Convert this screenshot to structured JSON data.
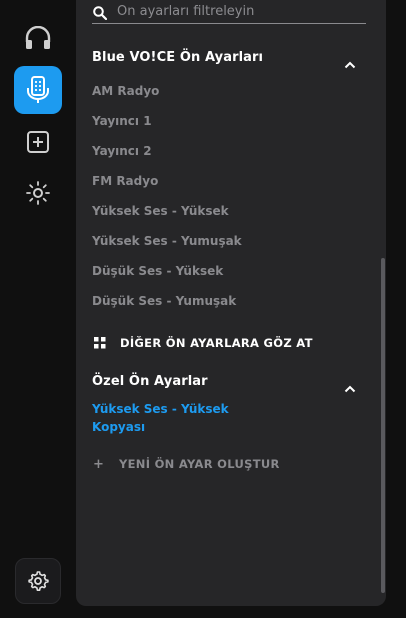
{
  "sidebar": {
    "items": [
      {
        "name": "headphones-icon",
        "active": false
      },
      {
        "name": "microphone-icon",
        "active": true
      },
      {
        "name": "add-icon",
        "active": false
      },
      {
        "name": "lighting-icon",
        "active": false
      }
    ],
    "settings_icon": "gear-icon"
  },
  "search": {
    "placeholder": "Ön ayarları filtreleyin",
    "value": ""
  },
  "blue_voice": {
    "title": "Blue VO!CE Ön Ayarları",
    "presets": [
      "AM Radyo",
      "Yayıncı 1",
      "Yayıncı 2",
      "FM Radyo",
      "Yüksek Ses - Yüksek",
      "Yüksek Ses - Yumuşak",
      "Düşük Ses - Yüksek",
      "Düşük Ses - Yumuşak"
    ],
    "browse_label": "DİĞER ÖN AYARLARA GÖZ AT"
  },
  "custom": {
    "title": "Özel Ön Ayarlar",
    "presets": [
      "Yüksek Ses - Yüksek Kopyası"
    ],
    "create_label": "YENİ ÖN AYAR OLUŞTUR"
  },
  "colors": {
    "accent": "#1d9bf0",
    "panel": "#262628",
    "background": "#101010",
    "muted_text": "#8a8a8e"
  }
}
